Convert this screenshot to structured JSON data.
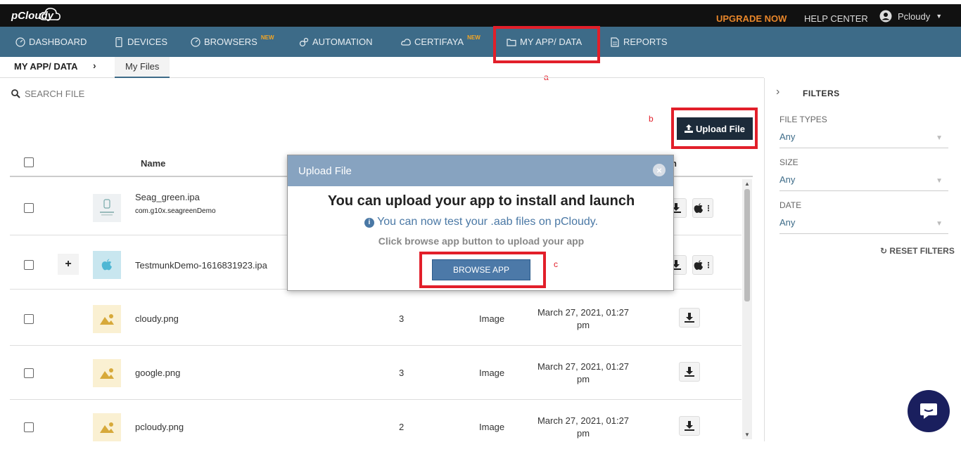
{
  "topbar": {
    "logo": "pCloudy",
    "upgrade": "UPGRADE NOW",
    "help": "HELP CENTER",
    "user": "Pcloudy"
  },
  "nav": {
    "items": [
      {
        "label": "DASHBOARD"
      },
      {
        "label": "DEVICES"
      },
      {
        "label": "BROWSERS",
        "badge": "NEW"
      },
      {
        "label": "AUTOMATION"
      },
      {
        "label": "CERTIFAYA",
        "badge": "NEW"
      },
      {
        "label": "MY APP/ DATA"
      },
      {
        "label": "REPORTS"
      }
    ]
  },
  "breadcrumb": {
    "section": "MY APP/ DATA",
    "tab": "My Files"
  },
  "search": {
    "placeholder": "SEARCH FILE"
  },
  "toolbar": {
    "upload_label": "Upload File"
  },
  "annotations": {
    "a": "a",
    "b": "b",
    "c": "c"
  },
  "table": {
    "header_name": "Name",
    "header_partial": "n",
    "rows": [
      {
        "name": "Seag_green.ipa",
        "sub": "com.g10x.seagreenDemo",
        "count": "",
        "type": "",
        "date": ""
      },
      {
        "name": "TestmunkDemo-1616831923.ipa",
        "sub": "",
        "count": "",
        "type": "",
        "date": ""
      },
      {
        "name": "cloudy.png",
        "sub": "",
        "count": "3",
        "type": "Image",
        "date": "March 27, 2021, 01:27 pm"
      },
      {
        "name": "google.png",
        "sub": "",
        "count": "3",
        "type": "Image",
        "date": "March 27, 2021, 01:27 pm"
      },
      {
        "name": "pcloudy.png",
        "sub": "",
        "count": "2",
        "type": "Image",
        "date": "March 27, 2021, 01:27 pm"
      }
    ]
  },
  "filters": {
    "title": "FILTERS",
    "file_types_label": "FILE TYPES",
    "file_types_value": "Any",
    "size_label": "SIZE",
    "size_value": "Any",
    "date_label": "DATE",
    "date_value": "Any",
    "reset": "RESET FILTERS"
  },
  "modal": {
    "header": "Upload File",
    "title": "You can upload your app to install and launch",
    "info": "You can now test your .aab files on pCloudy.",
    "hint": "Click browse app button to upload your app",
    "browse": "BROWSE APP"
  },
  "colors": {
    "nav_bg": "#3d6b88",
    "topbar_bg": "#111111",
    "accent_orange": "#e8862a",
    "annotation_red": "#e21f2a",
    "modal_header": "#87a3c0",
    "browse_btn": "#4c79a8",
    "upload_btn": "#1c2b3a"
  }
}
